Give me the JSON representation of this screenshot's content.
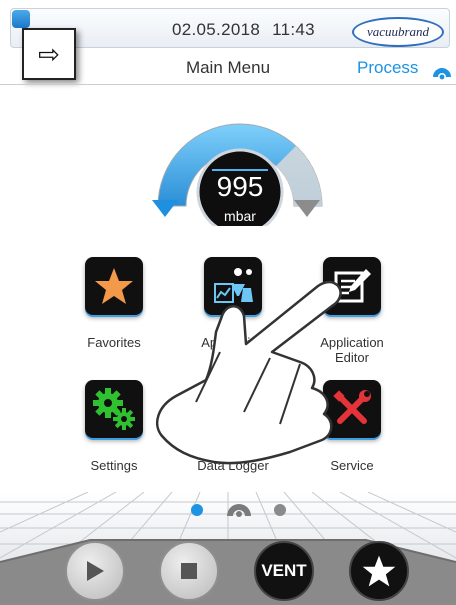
{
  "header": {
    "date": "02.05.2018",
    "time": "11:43",
    "brand": "vacuubrand",
    "title": "Main Menu",
    "process_label": "Process"
  },
  "gauge": {
    "value": "995",
    "unit": "mbar"
  },
  "apps": [
    {
      "label": "Favorites",
      "icon": "star-icon"
    },
    {
      "label": "Application",
      "icon": "applications-icon"
    },
    {
      "label": "Application\nEditor",
      "icon": "edit-icon"
    },
    {
      "label": "Settings",
      "icon": "gears-icon"
    },
    {
      "label": "Data Logger",
      "icon": "data-logger-icon"
    },
    {
      "label": "Service",
      "icon": "tools-icon"
    }
  ],
  "pager": {
    "pages": 3,
    "current": 1
  },
  "controls": {
    "vent_label": "VENT"
  },
  "colors": {
    "accent": "#1c93e3",
    "gauge_arc": "#4fb4ef",
    "icon_bg": "#101010",
    "star": "#f39a4a",
    "gears": "#2fc12f",
    "tools": "#e5333a"
  }
}
